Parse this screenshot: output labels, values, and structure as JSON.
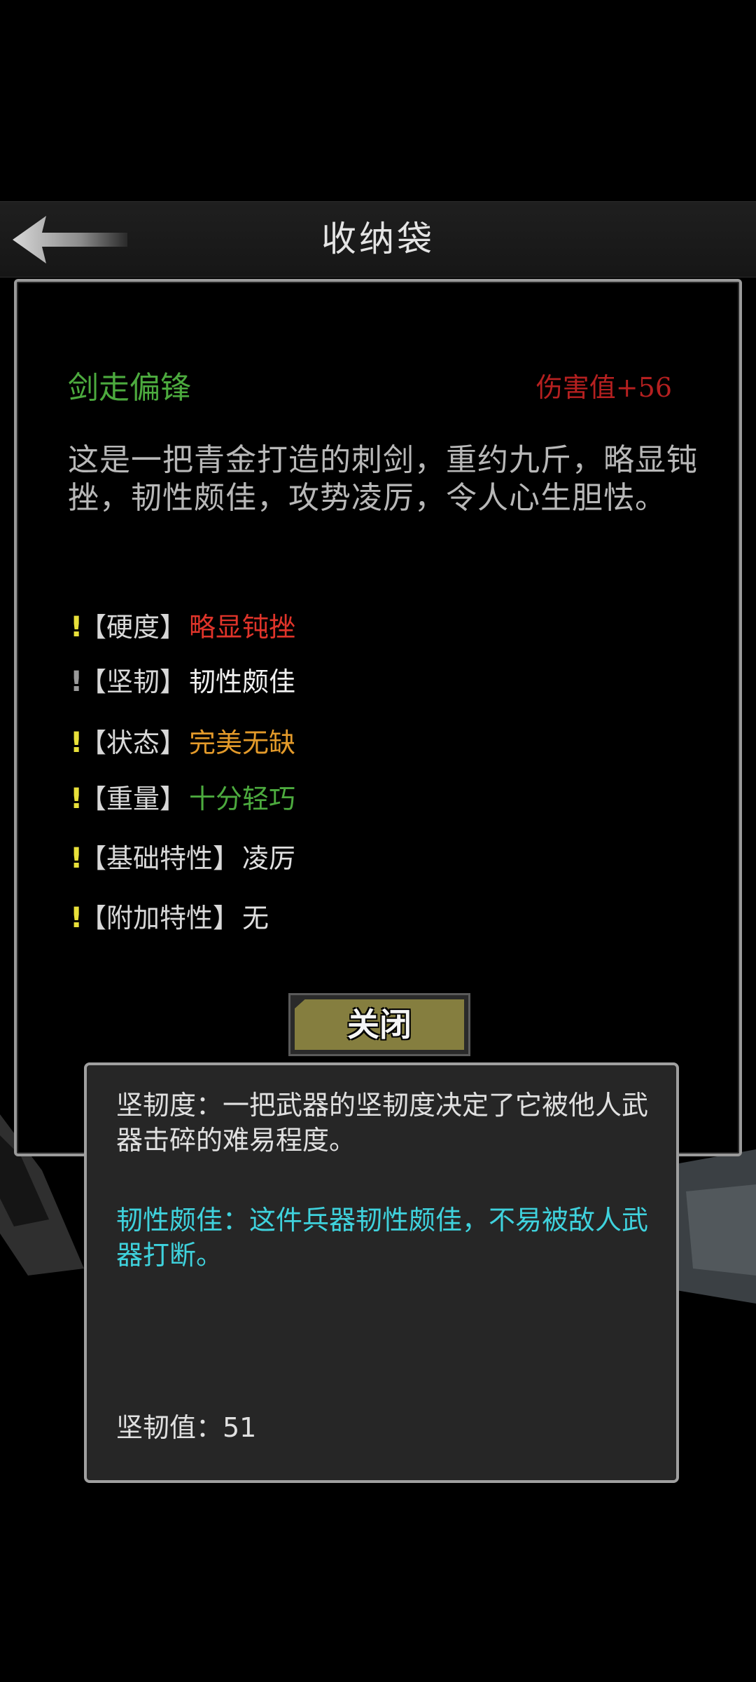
{
  "header": {
    "title": "收纳袋"
  },
  "item": {
    "name": "剑走偏锋",
    "damage": "伤害值+56",
    "description": "这是一把青金打造的刺剑，重约九斤，略显钝挫，韧性颇佳，攻势凌厉，令人心生胆怯。"
  },
  "attributes": [
    {
      "mark": "!",
      "label": "【硬度】",
      "value": "略显钝挫",
      "color": "#e0342a"
    },
    {
      "mark": "!",
      "label": "【坚韧】",
      "value": "韧性颇佳",
      "color": "#f0f0f0"
    },
    {
      "mark": "!",
      "label": "【状态】",
      "value": "完美无缺",
      "color": "#e39a2a"
    },
    {
      "mark": "!",
      "label": "【重量】",
      "value": "十分轻巧",
      "color": "#4caa3e"
    },
    {
      "mark": "!",
      "label": "【基础特性】",
      "value": "凌厉",
      "color": "#e0e0e0"
    },
    {
      "mark": "!",
      "label": "【附加特性】",
      "value": "无",
      "color": "#e0e0e0"
    }
  ],
  "close_button": {
    "label": "关闭"
  },
  "tooltip": {
    "definition": "坚韧度：一把武器的坚韧度决定了它被他人武器击碎的难易程度。",
    "detail": "韧性颇佳：这件兵器韧性颇佳，不易被敌人武器打断。",
    "value": "坚韧值：51"
  }
}
